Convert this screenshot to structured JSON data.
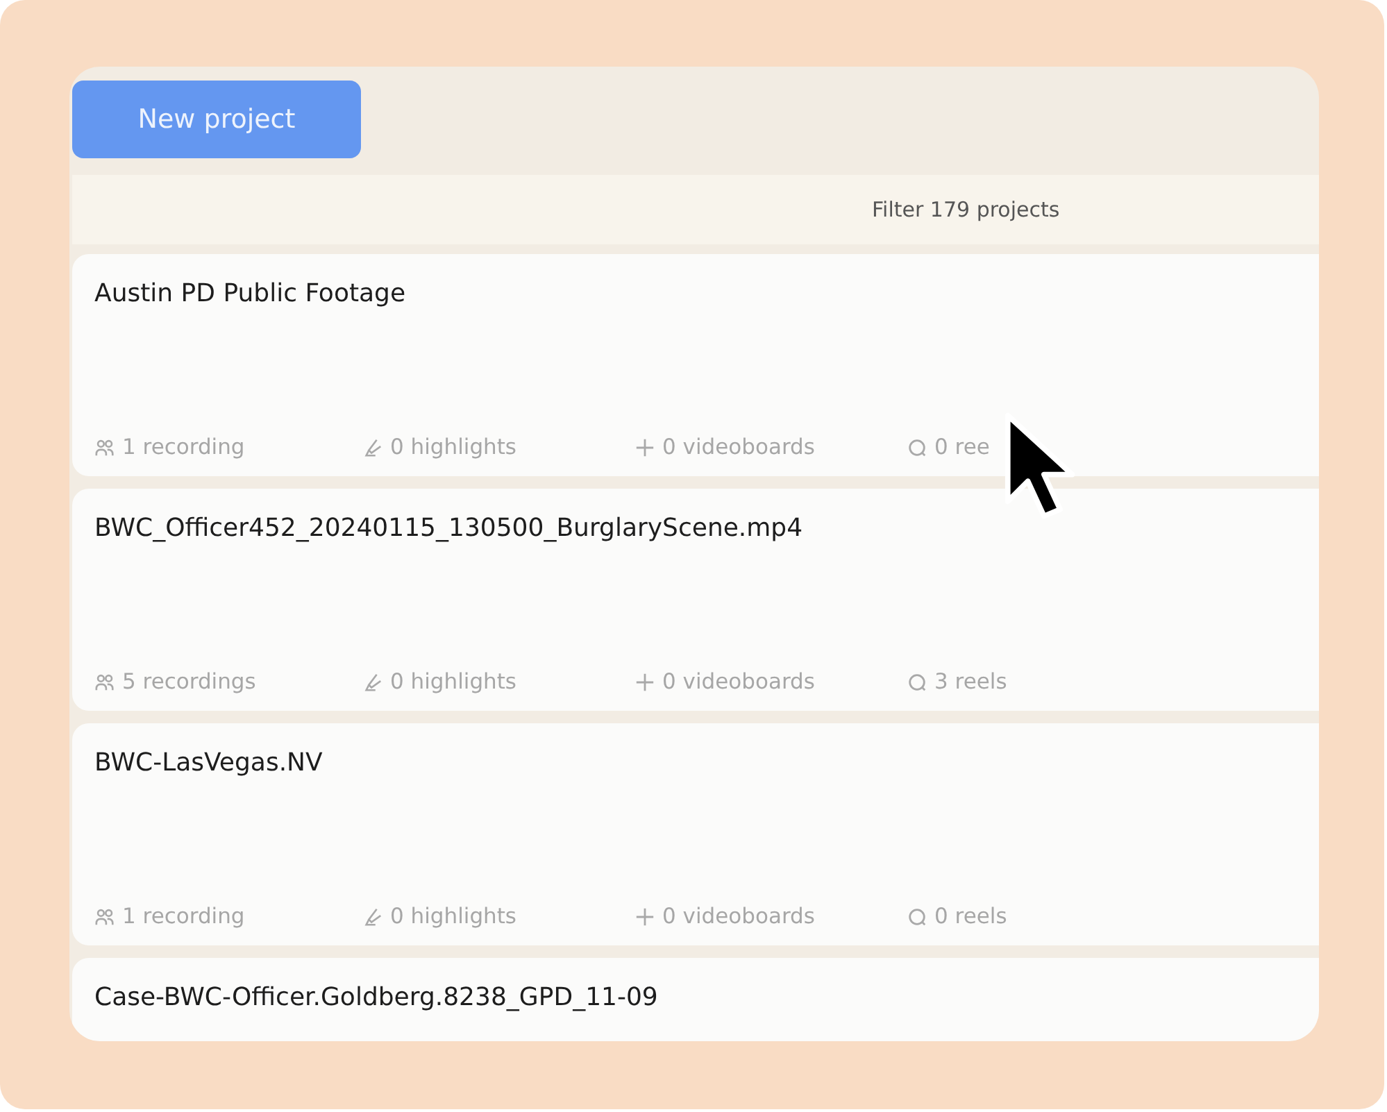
{
  "new_project_button": "New project",
  "filter": {
    "placeholder": "Filter 179 projects"
  },
  "projects": [
    {
      "title": "Austin PD Public Footage",
      "stats": [
        {
          "kind": "recordings",
          "text": "1 recording"
        },
        {
          "kind": "highlights",
          "text": "0 highlights"
        },
        {
          "kind": "videoboards",
          "text": "0 videoboards"
        },
        {
          "kind": "reels",
          "text": "0 ree"
        }
      ]
    },
    {
      "title": "BWC_Officer452_20240115_130500_BurglaryScene.mp4",
      "stats": [
        {
          "kind": "recordings",
          "text": "5 recordings"
        },
        {
          "kind": "highlights",
          "text": "0 highlights"
        },
        {
          "kind": "videoboards",
          "text": "0 videoboards"
        },
        {
          "kind": "reels",
          "text": "3 reels"
        }
      ]
    },
    {
      "title": "BWC-LasVegas.NV",
      "stats": [
        {
          "kind": "recordings",
          "text": "1 recording"
        },
        {
          "kind": "highlights",
          "text": "0 highlights"
        },
        {
          "kind": "videoboards",
          "text": "0 videoboards"
        },
        {
          "kind": "reels",
          "text": "0 reels"
        }
      ]
    },
    {
      "title": "Case-BWC-Officer.Goldberg.8238_GPD_11-09"
    }
  ]
}
